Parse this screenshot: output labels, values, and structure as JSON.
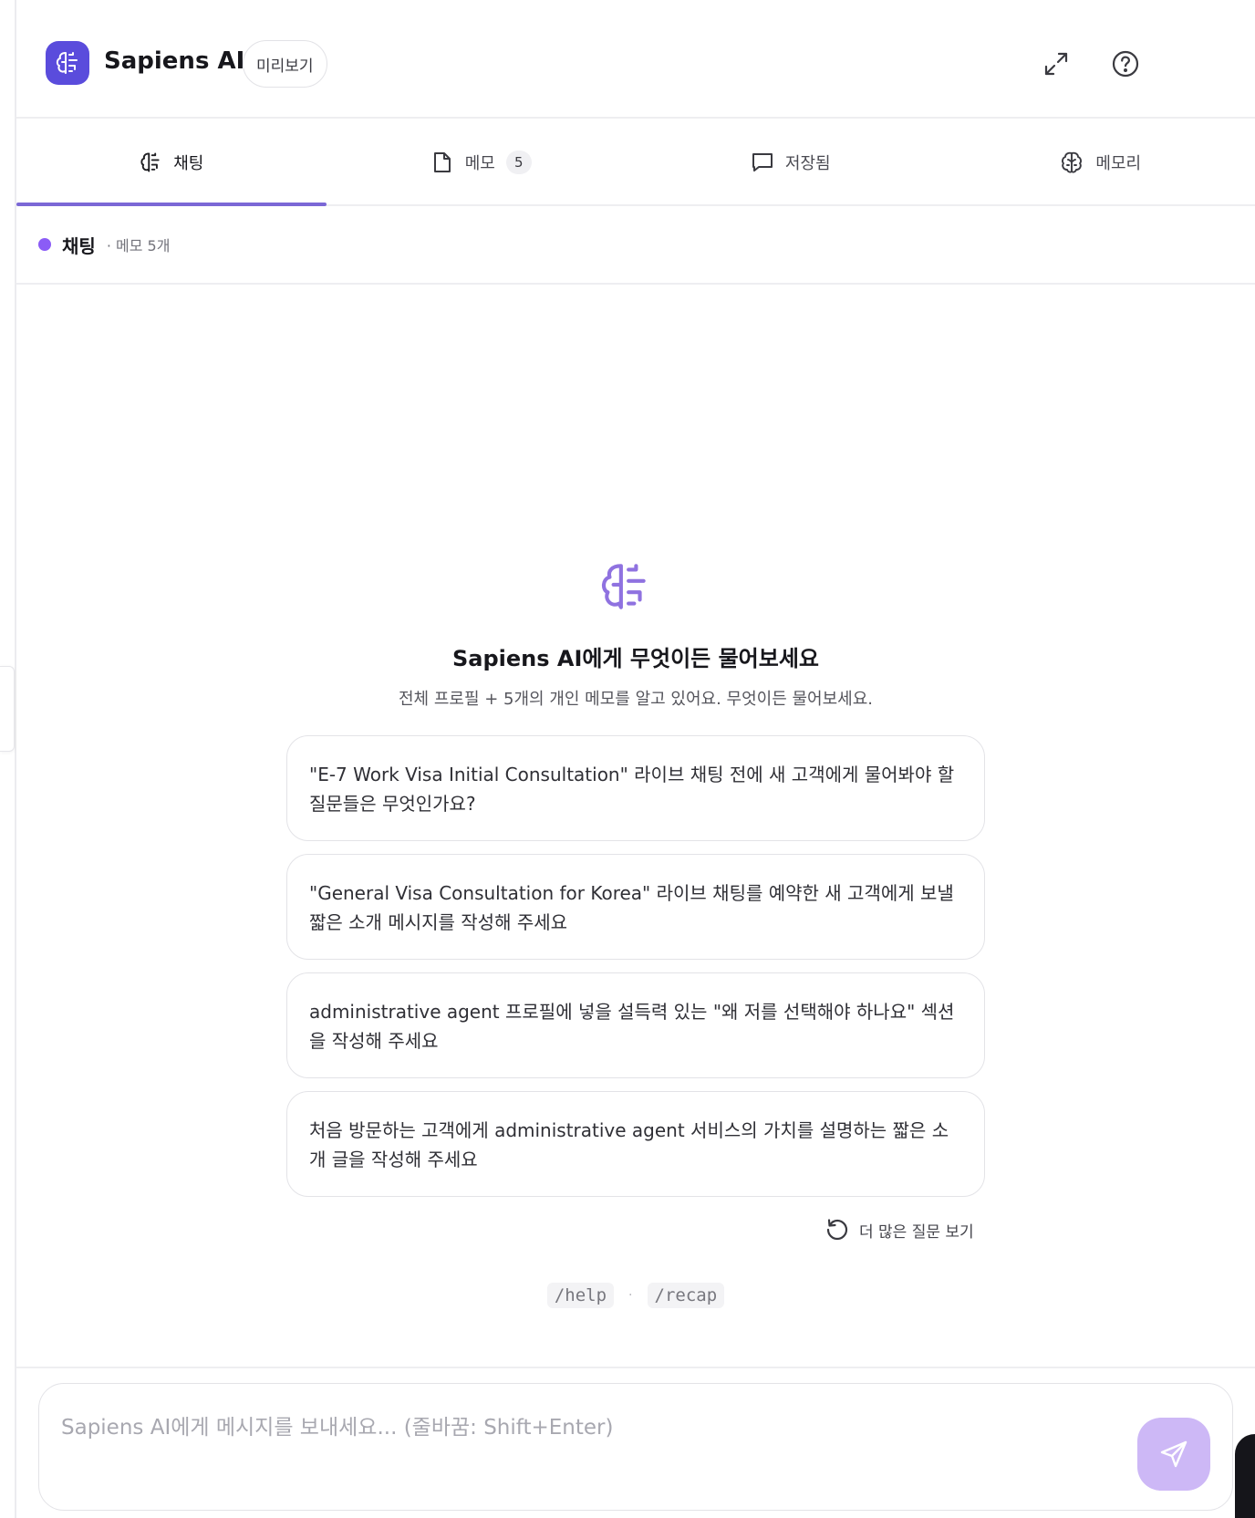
{
  "header": {
    "app_title": "Sapiens AI",
    "preview_label": "미리보기",
    "logo_icon": "brain-icon",
    "expand_icon": "expand-icon",
    "help_icon": "help-circle-icon"
  },
  "tabs": [
    {
      "label": "채팅",
      "icon": "brain-icon",
      "active": true
    },
    {
      "label": "메모",
      "icon": "document-icon",
      "count": "5"
    },
    {
      "label": "저장됨",
      "icon": "chat-bubble-icon"
    },
    {
      "label": "메모리",
      "icon": "brain-outline-icon"
    }
  ],
  "context": {
    "title": "채팅",
    "meta": "· 메모 5개"
  },
  "empty_state": {
    "title": "Sapiens AI에게 무엇이든 물어보세요",
    "subtitle": "전체 프로필 + 5개의 개인 메모를 알고 있어요. 무엇이든 물어보세요.",
    "suggestions": [
      "\"E-7 Work Visa Initial Consultation\" 라이브 채팅 전에 새 고객에게 물어봐야 할 질문들은 무엇인가요?",
      "\"General Visa Consultation for Korea\" 라이브 채팅를 예약한 새 고객에게 보낼 짧은 소개 메시지를 작성해 주세요",
      "administrative agent 프로필에 넣을 설득력 있는 \"왜 저를 선택해야 하나요\" 섹션을 작성해 주세요",
      "처음 방문하는 고객에게 administrative agent 서비스의 가치를 설명하는 짧은 소개 글을 작성해 주세요"
    ],
    "more_questions": "더 많은 질문 보기",
    "commands": [
      "/help",
      "/recap"
    ],
    "command_separator": "·"
  },
  "composer": {
    "placeholder": "Sapiens AI에게 메시지를 보내세요... (줄바꿈: Shift+Enter)",
    "value": "",
    "send_icon": "send-icon"
  },
  "colors": {
    "accent": "#7b68d6",
    "logo_bg": "#5a4cdc",
    "dot": "#8b5cf6",
    "send_button": "#cdb8f6"
  }
}
